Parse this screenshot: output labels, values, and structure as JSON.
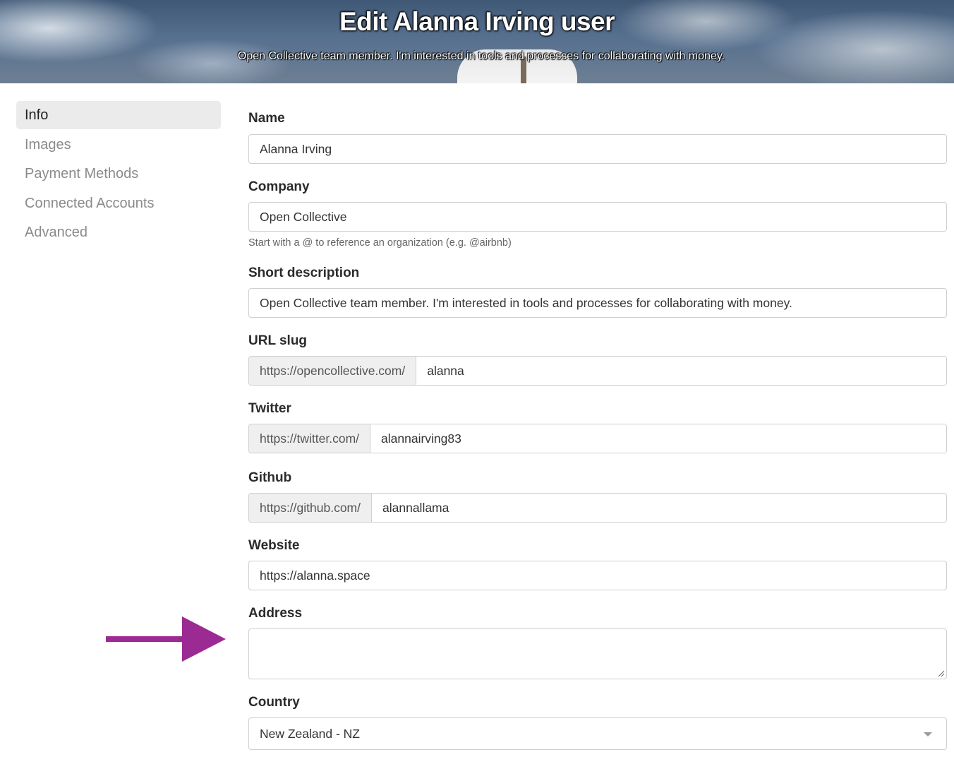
{
  "hero": {
    "title": "Edit Alanna Irving user",
    "subtitle": "Open Collective team member. I'm interested in tools and processes for collaborating with money."
  },
  "sidebar": {
    "items": [
      {
        "label": "Info",
        "active": true
      },
      {
        "label": "Images",
        "active": false
      },
      {
        "label": "Payment Methods",
        "active": false
      },
      {
        "label": "Connected Accounts",
        "active": false
      },
      {
        "label": "Advanced",
        "active": false
      }
    ]
  },
  "form": {
    "name": {
      "label": "Name",
      "value": "Alanna Irving"
    },
    "company": {
      "label": "Company",
      "value": "Open Collective",
      "help": "Start with a @ to reference an organization (e.g. @airbnb)"
    },
    "description": {
      "label": "Short description",
      "value": "Open Collective team member. I'm interested in tools and processes for collaborating with money."
    },
    "slug": {
      "label": "URL slug",
      "prefix": "https://opencollective.com/",
      "value": "alanna"
    },
    "twitter": {
      "label": "Twitter",
      "prefix": "https://twitter.com/",
      "value": "alannairving83"
    },
    "github": {
      "label": "Github",
      "prefix": "https://github.com/",
      "value": "alannallama"
    },
    "website": {
      "label": "Website",
      "value": "https://alanna.space"
    },
    "address": {
      "label": "Address",
      "value": ""
    },
    "country": {
      "label": "Country",
      "value": "New Zealand - NZ"
    }
  },
  "annotation": {
    "arrow_color": "#9b2a93",
    "icon": "arrow-right-icon"
  }
}
